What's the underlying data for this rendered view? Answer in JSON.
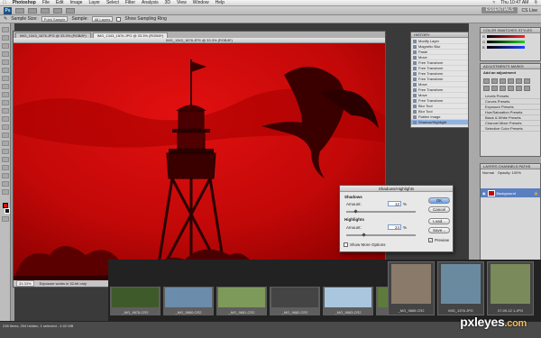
{
  "menubar": {
    "apple": "",
    "app_name": "Photoshop",
    "items": [
      "File",
      "Edit",
      "Image",
      "Layer",
      "Select",
      "Filter",
      "Analysis",
      "3D",
      "View",
      "Window",
      "Help"
    ],
    "clock": "Thu 10:47 AM"
  },
  "appbar": {
    "logo": "Ps",
    "workspace": "ESSENTIALS",
    "cs_live": "CS Live"
  },
  "options": {
    "sample_size_label": "Sample Size:",
    "sample_size_value": "Point Sample",
    "sample_label": "Sample:",
    "sample_value": "All Layers",
    "show_ring_label": "Show Sampling Ring"
  },
  "document": {
    "tabs": [
      "IMG_1343_1876.JPG @ 33.3% (RGB/8*)",
      "IMG_1343_1876.JPG @ 33.3% (RGB/8*)"
    ],
    "title": "IMG_1343_1876.JPG @ 33.3% (RGB/8*)",
    "zoom": "33.33%",
    "status": "Exposure works in 32-bit only"
  },
  "history": {
    "header": "HISTORY",
    "items": [
      "Modify Layer",
      "Magnetic Blur",
      "Paste",
      "Move",
      "Free Transform",
      "Free Transform",
      "Free Transform",
      "Free Transform",
      "Move",
      "Free Transform",
      "Move",
      "Free Transform",
      "Blur Tool",
      "Blur Tool",
      "Flatten Image",
      "Shadow/Highlight"
    ]
  },
  "color_panel": {
    "tabs": [
      "COLOR",
      "SWATCHES",
      "STYLES"
    ],
    "channels": [
      "R",
      "G",
      "B"
    ],
    "colors": {
      "r": "#ff2020",
      "g": "#20d020",
      "b": "#2040ff"
    }
  },
  "adjustments": {
    "tabs": [
      "ADJUSTMENTS",
      "MASKS"
    ],
    "subtitle": "Add an adjustment",
    "presets": [
      "Levels Presets",
      "Curves Presets",
      "Exposure Presets",
      "Hue/Saturation Presets",
      "Black & White Presets",
      "Channel Mixer Presets",
      "Selective Color Presets"
    ]
  },
  "layers": {
    "tabs": [
      "LAYERS",
      "CHANNELS",
      "PATHS"
    ],
    "mode": "Normal",
    "opacity": "Opacity: 100%",
    "layer_name": "Background"
  },
  "dialog": {
    "title": "Shadows/Highlights",
    "shadows_label": "Shadows",
    "shadows_amount_label": "Amount:",
    "shadows_amount": "12",
    "highlights_label": "Highlights",
    "highlights_amount_label": "Amount:",
    "highlights_amount": "24",
    "unit": "%",
    "ok": "OK",
    "cancel": "Cancel",
    "load": "Load...",
    "save": "Save...",
    "preview": "Preview",
    "show_more": "Show More Options",
    "shadows_level": 0.12,
    "highlights_level": 0.24
  },
  "filmstrip": {
    "thumbs": [
      {
        "caption": "_MG_9878.CR2",
        "color": "#3f5a2a"
      },
      {
        "caption": "_MG_9880.CR2",
        "color": "#6b8caa"
      },
      {
        "caption": "_MG_9881.CR2",
        "color": "#7e9a5a"
      },
      {
        "caption": "_MG_9882.CR2",
        "color": "#444444"
      },
      {
        "caption": "_MG_9883.CR2",
        "color": "#a9c6de"
      },
      {
        "caption": "_MG_9884.CR2",
        "color": "#5e7a3c"
      }
    ],
    "big": [
      {
        "caption": "_MG_9885.CR2",
        "color": "#8a7a6a"
      },
      {
        "caption": "IMG_1376.JPG",
        "color": "#6a8aa0"
      },
      {
        "caption": "07-09-12 1.JPG",
        "color": "#7a8a5a"
      }
    ]
  },
  "bridge_status": "238 items, 204 hidden, 1 selected - 4.02 MB",
  "watermark": {
    "name": "pxleyes",
    "tld": ".com"
  }
}
